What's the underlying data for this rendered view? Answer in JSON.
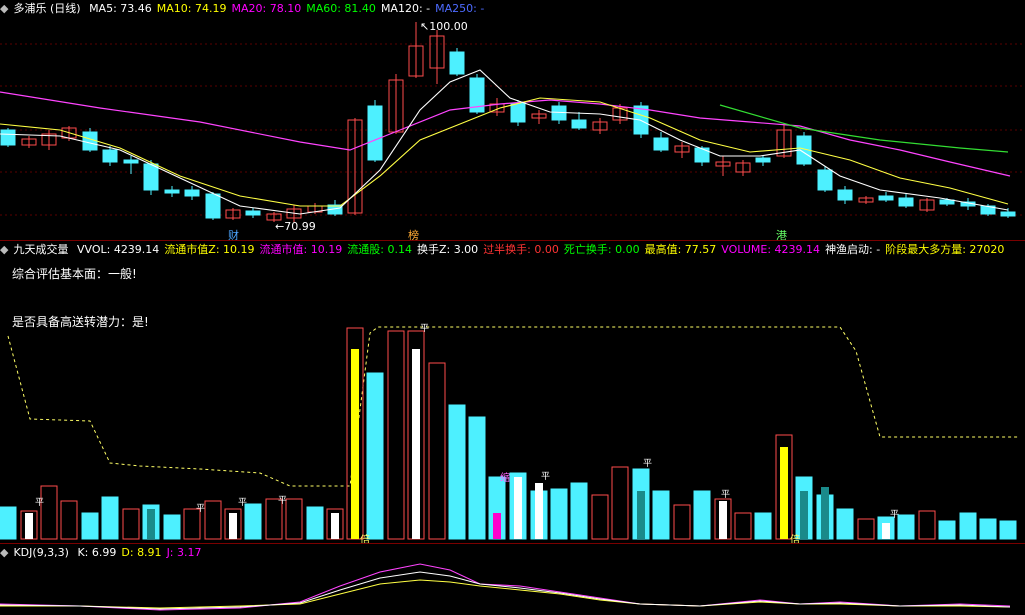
{
  "price_panel": {
    "title": "多浦乐 (日线)",
    "ma": [
      {
        "label": "MA5: 73.46",
        "color": "#ffffff"
      },
      {
        "label": "MA10: 74.19",
        "color": "#ffff00"
      },
      {
        "label": "MA20: 78.10",
        "color": "#ff00ff"
      },
      {
        "label": "MA60: 81.40",
        "color": "#00ff00"
      },
      {
        "label": "MA120: -",
        "color": "#ffffff"
      },
      {
        "label": "MA250: -",
        "color": "#4d6bff"
      }
    ],
    "high_label": "100.00",
    "low_label": "70.99",
    "markers": [
      {
        "text": "财",
        "color": "#4da6ff"
      },
      {
        "text": "榜",
        "color": "#ffaa33"
      },
      {
        "text": "港",
        "color": "#66ff66"
      }
    ]
  },
  "volume_panel": {
    "indicator": "九天成交量",
    "fields": [
      {
        "label": "VVOL: 4239.14",
        "color": "#ffffff"
      },
      {
        "label": "流通市值Z: 10.19",
        "color": "#ffff00"
      },
      {
        "label": "流通市值: 10.19",
        "color": "#ff00ff"
      },
      {
        "label": "流通股: 0.14",
        "color": "#00ff00"
      },
      {
        "label": "换手Z: 3.00",
        "color": "#ffffff"
      },
      {
        "label": "过半换手: 0.00",
        "color": "#ff3333"
      },
      {
        "label": "死亡换手: 0.00",
        "color": "#00ff00"
      },
      {
        "label": "最高值: 77.57",
        "color": "#ffff00"
      },
      {
        "label": "VOLUME: 4239.14",
        "color": "#ff00ff"
      },
      {
        "label": "神渔启动: -",
        "color": "#ffffff"
      },
      {
        "label": "阶段最大多方量: 27020",
        "color": "#ffff00"
      }
    ],
    "line1": "综合评估基本面：一般!",
    "line2": "是否具备高送转潜力：是!",
    "tag_ping": "平",
    "tag_bei": "倍",
    "tag_suo": "缩"
  },
  "kdj_panel": {
    "indicator": "KDJ(9,3,3)",
    "fields": [
      {
        "label": "K: 6.99",
        "color": "#ffffff"
      },
      {
        "label": "D: 8.91",
        "color": "#ffff00"
      },
      {
        "label": "J: 3.17",
        "color": "#ff00ff"
      }
    ]
  }
}
